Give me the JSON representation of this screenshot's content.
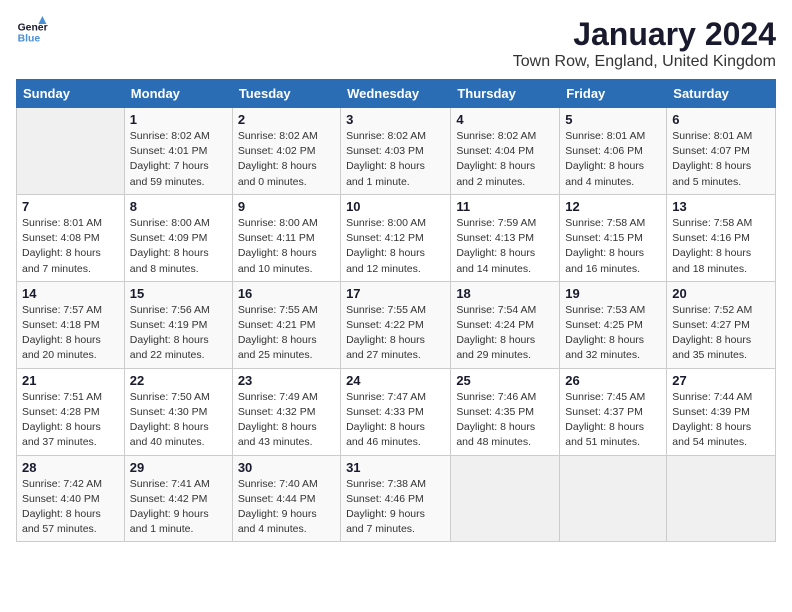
{
  "logo": {
    "text_general": "General",
    "text_blue": "Blue"
  },
  "header": {
    "title": "January 2024",
    "subtitle": "Town Row, England, United Kingdom"
  },
  "columns": [
    "Sunday",
    "Monday",
    "Tuesday",
    "Wednesday",
    "Thursday",
    "Friday",
    "Saturday"
  ],
  "weeks": [
    [
      {
        "day": "",
        "detail": ""
      },
      {
        "day": "1",
        "detail": "Sunrise: 8:02 AM\nSunset: 4:01 PM\nDaylight: 7 hours\nand 59 minutes."
      },
      {
        "day": "2",
        "detail": "Sunrise: 8:02 AM\nSunset: 4:02 PM\nDaylight: 8 hours\nand 0 minutes."
      },
      {
        "day": "3",
        "detail": "Sunrise: 8:02 AM\nSunset: 4:03 PM\nDaylight: 8 hours\nand 1 minute."
      },
      {
        "day": "4",
        "detail": "Sunrise: 8:02 AM\nSunset: 4:04 PM\nDaylight: 8 hours\nand 2 minutes."
      },
      {
        "day": "5",
        "detail": "Sunrise: 8:01 AM\nSunset: 4:06 PM\nDaylight: 8 hours\nand 4 minutes."
      },
      {
        "day": "6",
        "detail": "Sunrise: 8:01 AM\nSunset: 4:07 PM\nDaylight: 8 hours\nand 5 minutes."
      }
    ],
    [
      {
        "day": "7",
        "detail": "Sunrise: 8:01 AM\nSunset: 4:08 PM\nDaylight: 8 hours\nand 7 minutes."
      },
      {
        "day": "8",
        "detail": "Sunrise: 8:00 AM\nSunset: 4:09 PM\nDaylight: 8 hours\nand 8 minutes."
      },
      {
        "day": "9",
        "detail": "Sunrise: 8:00 AM\nSunset: 4:11 PM\nDaylight: 8 hours\nand 10 minutes."
      },
      {
        "day": "10",
        "detail": "Sunrise: 8:00 AM\nSunset: 4:12 PM\nDaylight: 8 hours\nand 12 minutes."
      },
      {
        "day": "11",
        "detail": "Sunrise: 7:59 AM\nSunset: 4:13 PM\nDaylight: 8 hours\nand 14 minutes."
      },
      {
        "day": "12",
        "detail": "Sunrise: 7:58 AM\nSunset: 4:15 PM\nDaylight: 8 hours\nand 16 minutes."
      },
      {
        "day": "13",
        "detail": "Sunrise: 7:58 AM\nSunset: 4:16 PM\nDaylight: 8 hours\nand 18 minutes."
      }
    ],
    [
      {
        "day": "14",
        "detail": "Sunrise: 7:57 AM\nSunset: 4:18 PM\nDaylight: 8 hours\nand 20 minutes."
      },
      {
        "day": "15",
        "detail": "Sunrise: 7:56 AM\nSunset: 4:19 PM\nDaylight: 8 hours\nand 22 minutes."
      },
      {
        "day": "16",
        "detail": "Sunrise: 7:55 AM\nSunset: 4:21 PM\nDaylight: 8 hours\nand 25 minutes."
      },
      {
        "day": "17",
        "detail": "Sunrise: 7:55 AM\nSunset: 4:22 PM\nDaylight: 8 hours\nand 27 minutes."
      },
      {
        "day": "18",
        "detail": "Sunrise: 7:54 AM\nSunset: 4:24 PM\nDaylight: 8 hours\nand 29 minutes."
      },
      {
        "day": "19",
        "detail": "Sunrise: 7:53 AM\nSunset: 4:25 PM\nDaylight: 8 hours\nand 32 minutes."
      },
      {
        "day": "20",
        "detail": "Sunrise: 7:52 AM\nSunset: 4:27 PM\nDaylight: 8 hours\nand 35 minutes."
      }
    ],
    [
      {
        "day": "21",
        "detail": "Sunrise: 7:51 AM\nSunset: 4:28 PM\nDaylight: 8 hours\nand 37 minutes."
      },
      {
        "day": "22",
        "detail": "Sunrise: 7:50 AM\nSunset: 4:30 PM\nDaylight: 8 hours\nand 40 minutes."
      },
      {
        "day": "23",
        "detail": "Sunrise: 7:49 AM\nSunset: 4:32 PM\nDaylight: 8 hours\nand 43 minutes."
      },
      {
        "day": "24",
        "detail": "Sunrise: 7:47 AM\nSunset: 4:33 PM\nDaylight: 8 hours\nand 46 minutes."
      },
      {
        "day": "25",
        "detail": "Sunrise: 7:46 AM\nSunset: 4:35 PM\nDaylight: 8 hours\nand 48 minutes."
      },
      {
        "day": "26",
        "detail": "Sunrise: 7:45 AM\nSunset: 4:37 PM\nDaylight: 8 hours\nand 51 minutes."
      },
      {
        "day": "27",
        "detail": "Sunrise: 7:44 AM\nSunset: 4:39 PM\nDaylight: 8 hours\nand 54 minutes."
      }
    ],
    [
      {
        "day": "28",
        "detail": "Sunrise: 7:42 AM\nSunset: 4:40 PM\nDaylight: 8 hours\nand 57 minutes."
      },
      {
        "day": "29",
        "detail": "Sunrise: 7:41 AM\nSunset: 4:42 PM\nDaylight: 9 hours\nand 1 minute."
      },
      {
        "day": "30",
        "detail": "Sunrise: 7:40 AM\nSunset: 4:44 PM\nDaylight: 9 hours\nand 4 minutes."
      },
      {
        "day": "31",
        "detail": "Sunrise: 7:38 AM\nSunset: 4:46 PM\nDaylight: 9 hours\nand 7 minutes."
      },
      {
        "day": "",
        "detail": ""
      },
      {
        "day": "",
        "detail": ""
      },
      {
        "day": "",
        "detail": ""
      }
    ]
  ]
}
